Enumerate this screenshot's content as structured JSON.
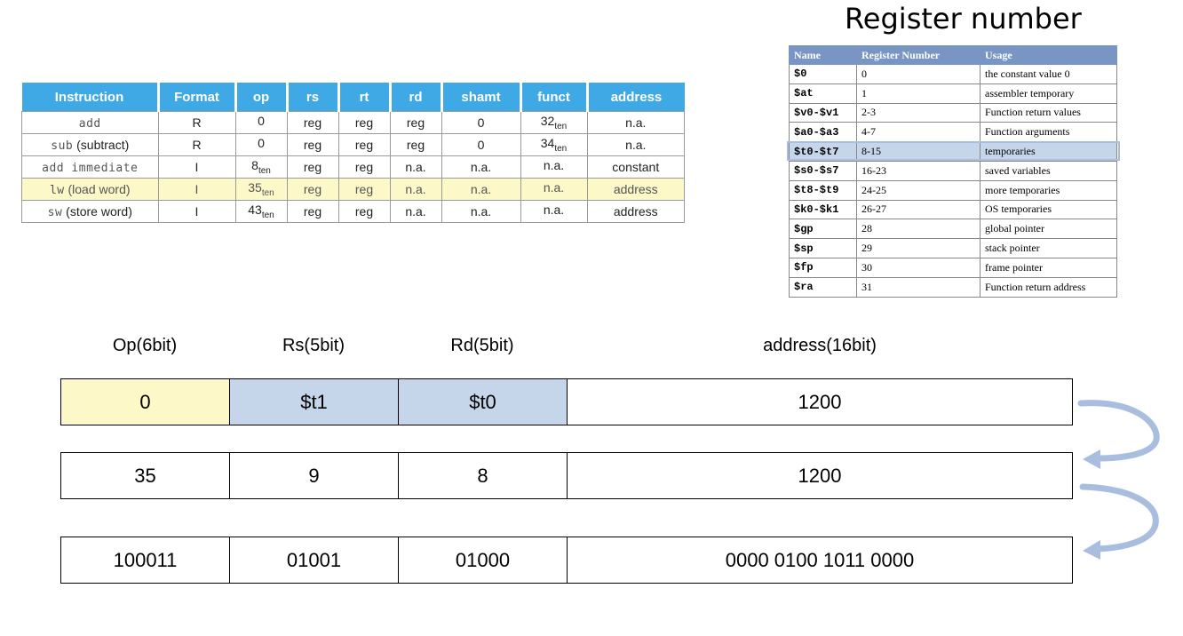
{
  "instruction_table": {
    "headers": [
      "Instruction",
      "Format",
      "op",
      "rs",
      "rt",
      "rd",
      "shamt",
      "funct",
      "address"
    ],
    "rows": [
      {
        "mnemonic": "add",
        "desc": "",
        "format": "R",
        "op": "0",
        "op_sub": "",
        "rs": "reg",
        "rt": "reg",
        "rd": "reg",
        "shamt": "0",
        "funct": "32",
        "funct_sub": "ten",
        "address": "n.a."
      },
      {
        "mnemonic": "sub",
        "desc": " (subtract)",
        "format": "R",
        "op": "0",
        "op_sub": "",
        "rs": "reg",
        "rt": "reg",
        "rd": "reg",
        "shamt": "0",
        "funct": "34",
        "funct_sub": "ten",
        "address": "n.a."
      },
      {
        "mnemonic": "add immediate",
        "desc": "",
        "format": "I",
        "op": "8",
        "op_sub": "ten",
        "rs": "reg",
        "rt": "reg",
        "rd": "n.a.",
        "shamt": "n.a.",
        "funct": "n.a.",
        "funct_sub": "",
        "address": "constant"
      },
      {
        "mnemonic": "lw",
        "desc": " (load word)",
        "format": "I",
        "op": "35",
        "op_sub": "ten",
        "rs": "reg",
        "rt": "reg",
        "rd": "n.a.",
        "shamt": "n.a.",
        "funct": "n.a.",
        "funct_sub": "",
        "address": "address"
      },
      {
        "mnemonic": "sw",
        "desc": " (store word)",
        "format": "I",
        "op": "43",
        "op_sub": "ten",
        "rs": "reg",
        "rt": "reg",
        "rd": "n.a.",
        "shamt": "n.a.",
        "funct": "n.a.",
        "funct_sub": "",
        "address": "address"
      }
    ],
    "highlight_color": "#fcf8c8",
    "header_color": "#3fa9e6"
  },
  "register_table": {
    "title": "Register number",
    "headers": [
      "Name",
      "Register Number",
      "Usage"
    ],
    "rows": [
      {
        "name": "$0",
        "number": "0",
        "usage": "the constant value 0"
      },
      {
        "name": "$at",
        "number": "1",
        "usage": "assembler temporary"
      },
      {
        "name": "$v0-$v1",
        "number": "2-3",
        "usage": "Function return values"
      },
      {
        "name": "$a0-$a3",
        "number": "4-7",
        "usage": "Function arguments"
      },
      {
        "name": "$t0-$t7",
        "number": "8-15",
        "usage": "temporaries"
      },
      {
        "name": "$s0-$s7",
        "number": "16-23",
        "usage": "saved variables"
      },
      {
        "name": "$t8-$t9",
        "number": "24-25",
        "usage": "more temporaries"
      },
      {
        "name": "$k0-$k1",
        "number": "26-27",
        "usage": "OS temporaries"
      },
      {
        "name": "$gp",
        "number": "28",
        "usage": "global pointer"
      },
      {
        "name": "$sp",
        "number": "29",
        "usage": "stack pointer"
      },
      {
        "name": "$fp",
        "number": "30",
        "usage": "frame pointer"
      },
      {
        "name": "$ra",
        "number": "31",
        "usage": "Function return address"
      }
    ],
    "header_color": "#7895c4",
    "highlight_color": "#c5d5ea"
  },
  "fields": {
    "labels": {
      "op": "Op(6bit)",
      "rs": "Rs(5bit)",
      "rd": "Rd(5bit)",
      "address": "address(16bit)"
    },
    "rows": [
      {
        "op": "0",
        "rs": "$t1",
        "rd": "$t0",
        "address": "1200"
      },
      {
        "op": "35",
        "rs": "9",
        "rd": "8",
        "address": "1200"
      },
      {
        "op": "100011",
        "rs": "01001",
        "rd": "01000",
        "address": "0000 0100 1011 0000"
      }
    ],
    "op_highlight_color": "#fcf8c8",
    "reg_highlight_color": "#c5d5ea",
    "arrow_color": "#a9bedf"
  }
}
